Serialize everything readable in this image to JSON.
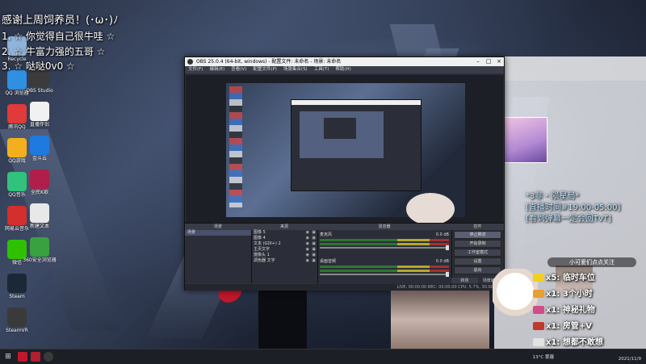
{
  "overlay": {
    "thanks": "感谢上周饲养员！(･ω･)ﾉ",
    "rank1": "1.  ☆  你觉得自己很牛哇  ☆",
    "rank2": "2.  ☆  牛富力强的五哥  ☆",
    "rank3": "3.  ☆    哒哒0v0   ☆"
  },
  "desktop_icons": [
    {
      "label": "Recycle",
      "color": "#8fb3d9"
    },
    {
      "label": "QQ 浏览器",
      "color": "#2f8fe0"
    },
    {
      "label": "腾讯QQ",
      "color": "#e03a3a"
    },
    {
      "label": "QQ游戏",
      "color": "#f2b01e"
    },
    {
      "label": "QQ音乐",
      "color": "#31c27c"
    },
    {
      "label": "网易云音乐",
      "color": "#d42e2e"
    },
    {
      "label": "微信",
      "color": "#2dc100"
    },
    {
      "label": "Steam",
      "color": "#1b2838"
    },
    {
      "label": "SteamVR",
      "color": "#3a3a3a"
    }
  ],
  "desktop_icons_col2": [
    {
      "label": "OBS Studio",
      "color": "#3b3b3b"
    },
    {
      "label": "直播伴侣",
      "color": "#f1f1f1"
    },
    {
      "label": "金斗云",
      "color": "#1f7adf"
    },
    {
      "label": "全民K歌",
      "color": "#b01e4a"
    },
    {
      "label": "新建文本",
      "color": "#e8e8e8"
    },
    {
      "label": "360安全浏览器",
      "color": "#3aa140"
    }
  ],
  "obs": {
    "title": "OBS 25.0.4 (64-bit, windows) - 配置文件: 未命名 - 场景: 未命名",
    "menu": [
      "文件(F)",
      "编辑(E)",
      "查看(V)",
      "配置文件(P)",
      "场景集合(S)",
      "工具(T)",
      "帮助(H)"
    ],
    "panels": {
      "scenes_header": "场景",
      "sources_header": "来源",
      "mixer_header": "混音器",
      "controls_header": "控件"
    },
    "scenes": [
      "场景"
    ],
    "sources": [
      "图像 5",
      "图像 4",
      "文本 (GDI+) 2",
      "主页文字",
      "摄像头 1",
      "调色器 文字"
    ],
    "mixer": [
      {
        "name": "麦克风",
        "db": "0.0 dB"
      },
      {
        "name": "桌面音频",
        "db": "0.0 dB"
      }
    ],
    "controls": [
      "停止推流",
      "开始录制",
      "工作室模式",
      "设置",
      "退出"
    ],
    "controls_tabs": [
      "转场",
      "场景转换"
    ],
    "status": "LIVE: 00:00:00   REC: 00:00:00   CPU: 5.7%, 30.00 fps"
  },
  "stream_info": {
    "line1": "*3非・陨星局*",
    "line2": "[直播时间#19:00-05:00]",
    "line3": "[看到弹幕一定会回TvT]"
  },
  "gifts_title": "小可爱们点点关注",
  "gifts": [
    {
      "text": "x5: 临时车位",
      "color": "#f0d020"
    },
    {
      "text": "x1: 3个小时",
      "color": "#e8a030"
    },
    {
      "text": "x1: 神秘礼物",
      "color": "#d24b8a"
    },
    {
      "text": "x1: 房管+V",
      "color": "#c0392b"
    },
    {
      "text": "x1: 想都不敢想",
      "color": "#e2e2e2"
    }
  ],
  "tray": {
    "weather": "13°C 雾霾",
    "date": "2021/11/9"
  }
}
